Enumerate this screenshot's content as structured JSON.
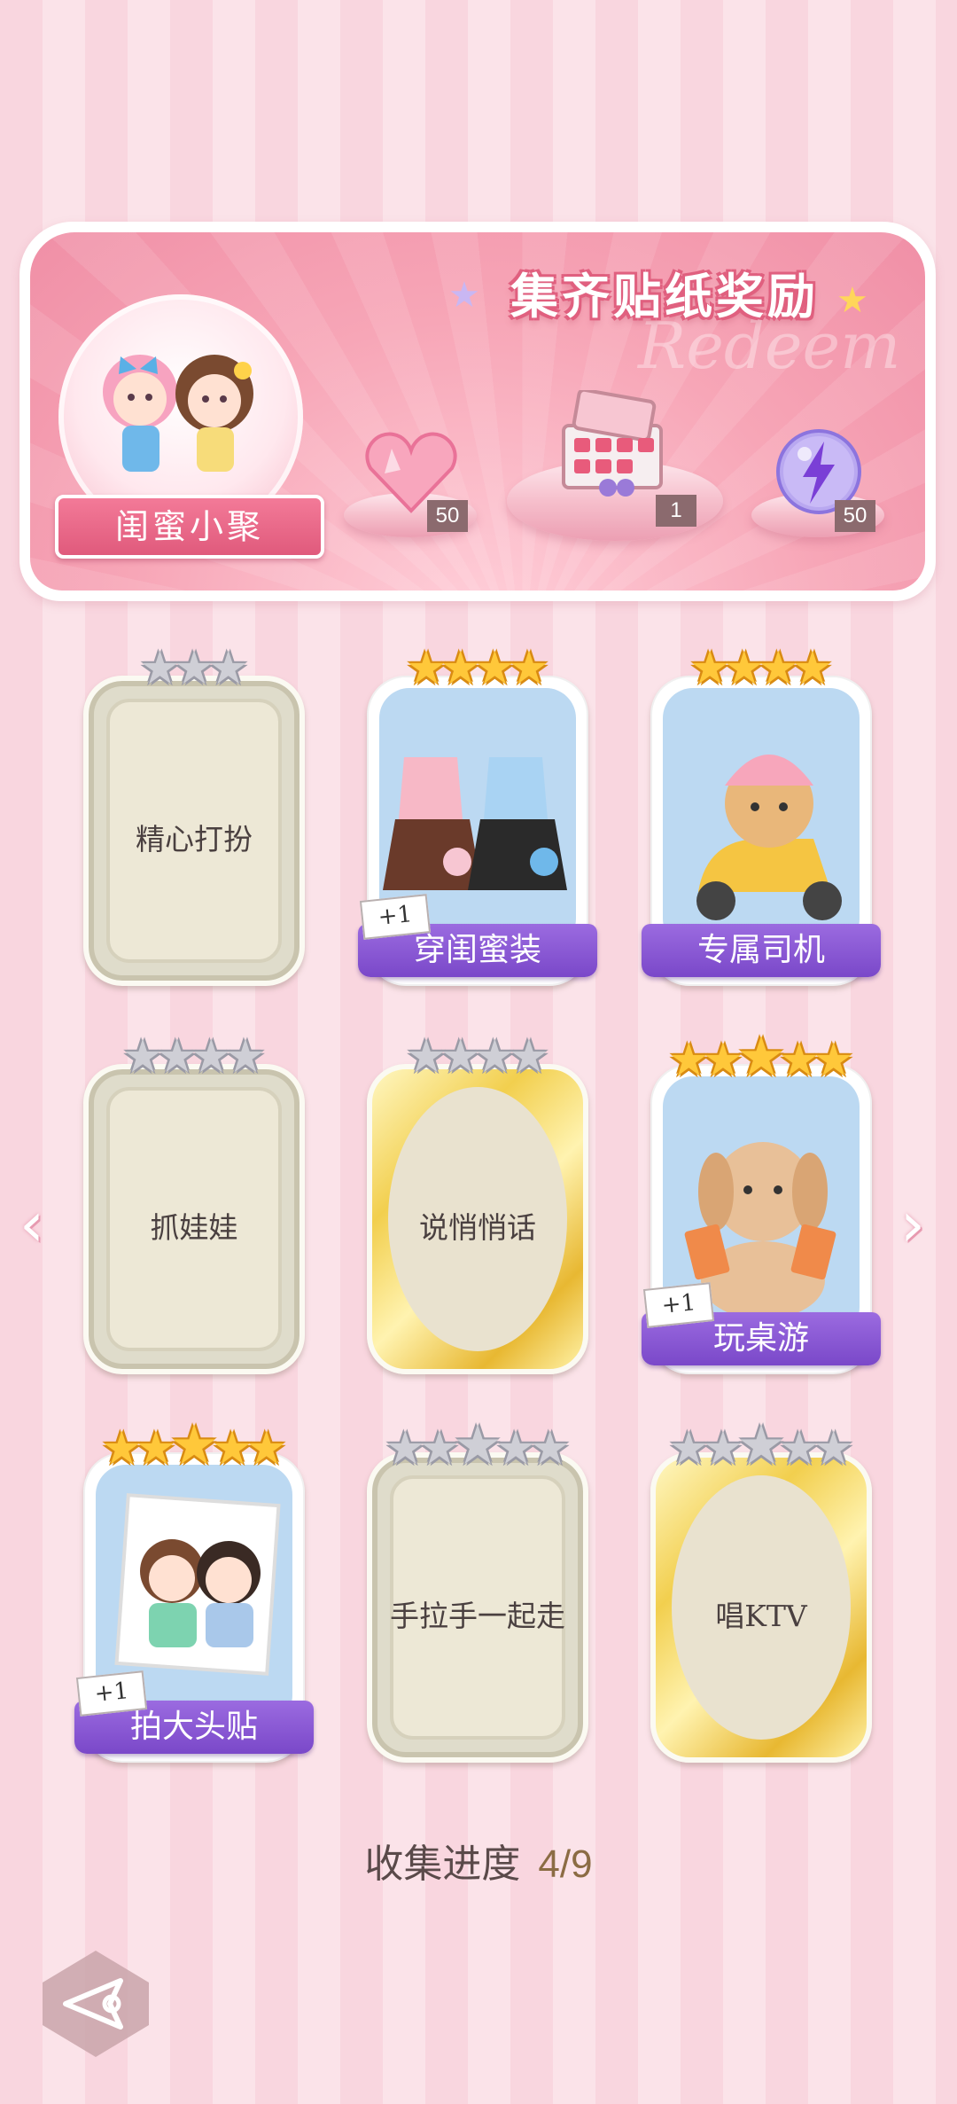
{
  "banner": {
    "title": "集齐贴纸奖励",
    "watermark": "Redeem",
    "event_name": "闺蜜小聚",
    "rewards": [
      {
        "icon": "pink-heart-gem-icon",
        "count": "50"
      },
      {
        "icon": "gift-box-icon",
        "count": "1"
      },
      {
        "icon": "purple-lightning-orb-icon",
        "count": "50"
      }
    ]
  },
  "cards": [
    {
      "label": "精心打扮",
      "stars": 3,
      "filled_stars": 0,
      "frame": "plain",
      "unlocked": false
    },
    {
      "label": "穿闺蜜装",
      "stars": 4,
      "filled_stars": 4,
      "frame": "art",
      "unlocked": true,
      "badge": "+1"
    },
    {
      "label": "专属司机",
      "stars": 4,
      "filled_stars": 4,
      "frame": "art",
      "unlocked": true
    },
    {
      "label": "抓娃娃",
      "stars": 4,
      "filled_stars": 0,
      "frame": "plain",
      "unlocked": false
    },
    {
      "label": "说悄悄话",
      "stars": 4,
      "filled_stars": 0,
      "frame": "gold",
      "unlocked": false
    },
    {
      "label": "玩桌游",
      "stars": 5,
      "filled_stars": 5,
      "frame": "art",
      "unlocked": true,
      "badge": "+1"
    },
    {
      "label": "拍大头贴",
      "stars": 5,
      "filled_stars": 5,
      "frame": "art",
      "unlocked": true,
      "badge": "+1"
    },
    {
      "label": "手拉手一起走",
      "stars": 5,
      "filled_stars": 0,
      "frame": "plain",
      "unlocked": false
    },
    {
      "label": "唱KTV",
      "stars": 5,
      "filled_stars": 0,
      "frame": "gold",
      "unlocked": false
    }
  ],
  "progress": {
    "label": "收集进度",
    "value": "4/9"
  },
  "nav": {
    "prev": "‹",
    "next": "›"
  }
}
